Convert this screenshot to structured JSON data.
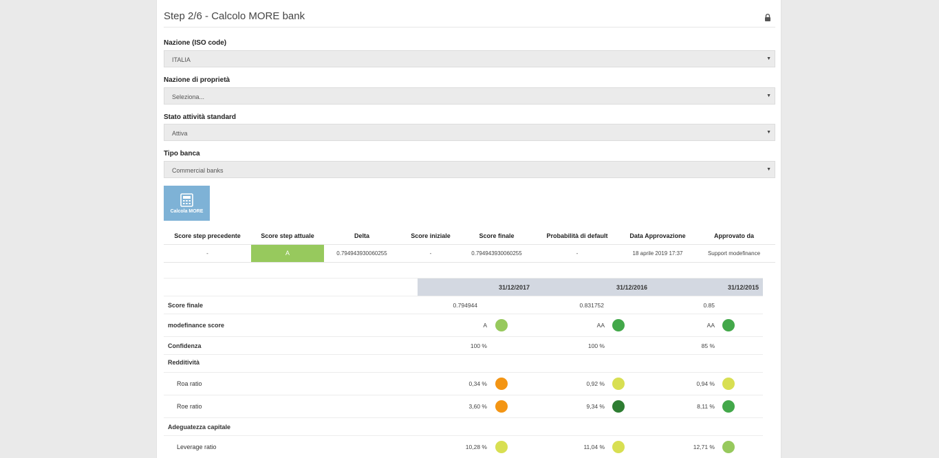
{
  "header": {
    "title": "Step 2/6 - Calcolo MORE bank",
    "lock_icon": "lock-icon"
  },
  "form": {
    "nazione_label": "Nazione (ISO code)",
    "nazione_value": "ITALIA",
    "proprieta_label": "Nazione di proprietà",
    "proprieta_value": "Seleziona...",
    "stato_label": "Stato attività standard",
    "stato_value": "Attiva",
    "tipo_label": "Tipo banca",
    "tipo_value": "Commercial banks",
    "arrow": "▼"
  },
  "calc_button": {
    "label": "Calcola MORE",
    "icon": "calculator-icon"
  },
  "scores_table": {
    "headers": [
      "Score step precedente",
      "Score step attuale",
      "Delta",
      "Score iniziale",
      "Score finale",
      "Probabilità di default",
      "Data Approvazione",
      "Approvato da"
    ],
    "row": [
      "-",
      "A",
      "0.794943930060255",
      "-",
      "0.794943930060255",
      "-",
      "18 aprile 2019 17:37",
      "Support modefinance"
    ]
  },
  "financials": {
    "years": [
      "31/12/2017",
      "31/12/2016",
      "31/12/2015"
    ],
    "rows": [
      {
        "label": "Score finale",
        "values": [
          "0.794944",
          "0.831752",
          "0.85"
        ]
      },
      {
        "label": "modefinance score",
        "values": [
          "A",
          "AA",
          "AA"
        ],
        "colors": [
          "#97c95d",
          "#43a84a",
          "#43a84a"
        ]
      },
      {
        "label": "Confidenza",
        "values": [
          "100 %",
          "100 %",
          "85 %"
        ]
      },
      {
        "label": "Redditività"
      },
      {
        "label": "Roa ratio",
        "values": [
          "0,34 %",
          "0,92 %",
          "0,94 %"
        ],
        "colors": [
          "#f39514",
          "#d8df52",
          "#d8df52"
        ]
      },
      {
        "label": "Roe ratio",
        "values": [
          "3,60 %",
          "9,34 %",
          "8,11 %"
        ],
        "colors": [
          "#f39514",
          "#2e7d32",
          "#43a84a"
        ]
      },
      {
        "label": "Adeguatezza capitale"
      },
      {
        "label": "Leverage ratio",
        "values": [
          "10,28 %",
          "11,04 %",
          "12,71 %"
        ],
        "colors": [
          "#d8df52",
          "#d8df52",
          "#97c95d"
        ]
      }
    ]
  }
}
